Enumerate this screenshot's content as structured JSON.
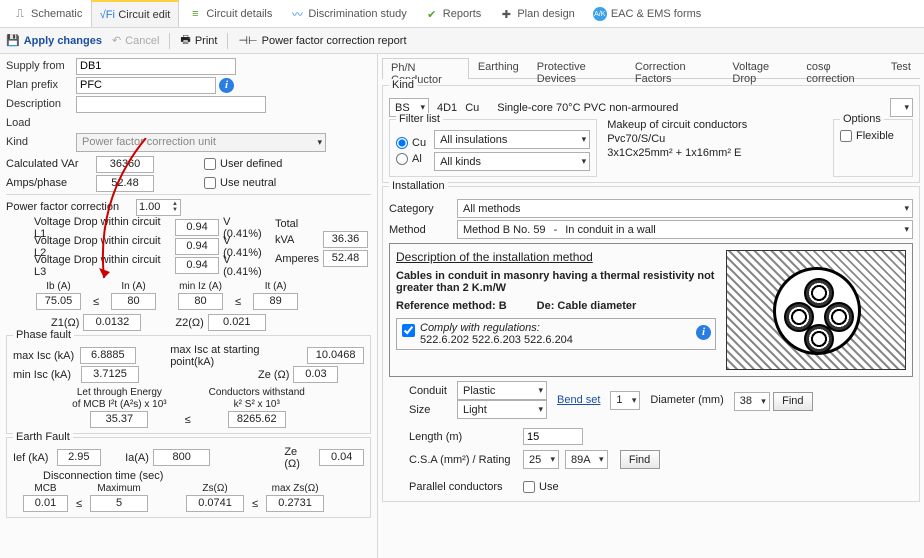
{
  "top_tabs": {
    "schematic": "Schematic",
    "circuit_edit": "Circuit edit",
    "circuit_details": "Circuit details",
    "discrimination": "Discrimination study",
    "reports": "Reports",
    "plan_design": "Plan design",
    "eac_ems": "EAC & EMS forms"
  },
  "actions": {
    "apply": "Apply changes",
    "cancel": "Cancel",
    "print": "Print",
    "pfc_report": "Power factor correction report"
  },
  "left": {
    "supply_from_lbl": "Supply from",
    "supply_from": "DB1",
    "plan_prefix_lbl": "Plan prefix",
    "plan_prefix": "PFC",
    "description_lbl": "Description",
    "description": "",
    "load_lbl": "Load",
    "kind_lbl": "Kind",
    "kind": "Power factor correction unit",
    "calc_var_lbl": "Calculated VAr",
    "calc_var": "36360",
    "amps_lbl": "Amps/phase",
    "amps": "52.48",
    "user_defined": "User defined",
    "use_neutral": "Use neutral",
    "pf_correction_lbl": "Power factor correction",
    "pf_correction": "1.00",
    "vd": {
      "l1_lbl": "Voltage Drop within circuit L1",
      "l2_lbl": "Voltage Drop within circuit L2",
      "l3_lbl": "Voltage Drop within circuit L3",
      "l1": "0.94",
      "l2": "0.94",
      "l3": "0.94",
      "pct": "V (0.41%)",
      "total_lbl": "Total",
      "kva_lbl": "kVA",
      "kva": "36.36",
      "amp_lbl": "Amperes",
      "amp": "52.48"
    },
    "ibia": {
      "ib_lbl": "Ib (A)",
      "ib": "75.05",
      "in_lbl": "In (A)",
      "in": "80",
      "miniz_lbl": "min Iz (A)",
      "miniz": "80",
      "it_lbl": "It (A)",
      "it": "89",
      "le": "≤"
    },
    "z": {
      "z1_lbl": "Z1(Ω)",
      "z1": "0.0132",
      "z2_lbl": "Z2(Ω)",
      "z2": "0.021"
    },
    "phase_fault": {
      "title": "Phase fault",
      "maxisc_lbl": "max Isc (kA)",
      "maxisc": "6.8885",
      "maxisc_start_lbl": "max Isc at starting point(kA)",
      "maxisc_start": "10.0468",
      "minisc_lbl": "min Isc (kA)",
      "minisc": "3.7125",
      "ze_lbl": "Ze (Ω)",
      "ze": "0.03",
      "lte_lbl1": "Let through Energy",
      "lte_lbl2": "of MCB I²t (A²s) x 10³",
      "lte": "35.37",
      "cw_lbl1": "Conductors withstand",
      "cw_lbl2": "k² S² x 10³",
      "cw": "8265.62",
      "le": "≤"
    },
    "earth_fault": {
      "title": "Earth Fault",
      "ief_lbl": "Ief (kA)",
      "ief": "2.95",
      "ia_lbl": "Ia(A)",
      "ia": "800",
      "ze_lbl": "Ze (Ω)",
      "ze": "0.04",
      "disc_lbl": "Disconnection time (sec)",
      "mcb_lbl": "MCB",
      "mcb": "0.01",
      "max_lbl": "Maximum",
      "max": "5",
      "zs_lbl": "Zs(Ω)",
      "zs": "0.0741",
      "maxzs_lbl": "max Zs(Ω)",
      "maxzs": "0.2731",
      "le": "≤"
    }
  },
  "right": {
    "tabs": {
      "phn": "Ph/N Conductor",
      "earthing": "Earthing",
      "protective": "Protective Devices",
      "correction": "Correction Factors",
      "vdrop": "Voltage Drop",
      "cosphi": "cosφ correction",
      "test": "Test"
    },
    "kind": {
      "title": "Kind",
      "std": "BS",
      "size": "4D1",
      "mat": "Cu",
      "desc": "Single-core 70°C PVC non-armoured"
    },
    "filter": {
      "title": "Filter list",
      "cu": "Cu",
      "al": "Al",
      "insul": "All insulations",
      "kinds": "All kinds"
    },
    "makeup": {
      "title": "Makeup of circuit conductors",
      "l1": "Pvc70/S/Cu",
      "l2": "3x1Cx25mm² + 1x16mm² E"
    },
    "options": {
      "title": "Options",
      "flex": "Flexible"
    },
    "install": {
      "title": "Installation",
      "cat_lbl": "Category",
      "cat": "All methods",
      "method_lbl": "Method",
      "method_no": "Method B No. 59",
      "method_sep": "-",
      "method_desc": "In conduit in a wall",
      "desc_title": "Description of the installation method",
      "desc_body": "Cables in conduit in masonry having a thermal resistivity not greater than 2 K.m/W",
      "ref": "Reference method: B",
      "de": "De: Cable diameter",
      "comply_lbl": "Comply with regulations:",
      "comply_refs": "522.6.202 522.6.203 522.6.204",
      "conduit_lbl": "Conduit",
      "conduit": "Plastic",
      "size_lbl": "Size",
      "size": "Light",
      "bendset": "Bend set",
      "bendset_v": "1",
      "diam_lbl": "Diameter (mm)",
      "diam": "38",
      "find": "Find",
      "length_lbl": "Length (m)",
      "length": "15",
      "csa_lbl": "C.S.A (mm²) / Rating",
      "csa": "25",
      "csa_a": "89A",
      "par_lbl": "Parallel conductors",
      "use": "Use"
    }
  }
}
